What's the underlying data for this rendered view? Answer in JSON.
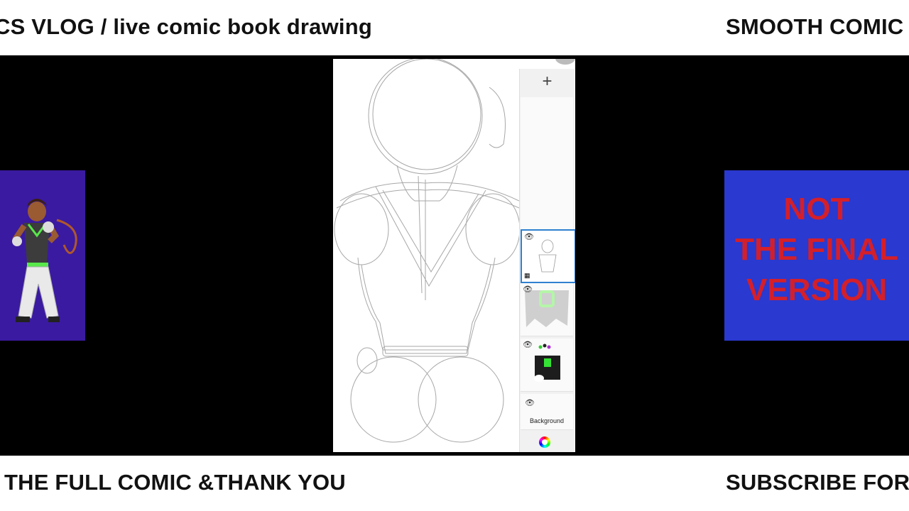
{
  "top_ticker": {
    "left_text": "CS VLOG / live comic book drawing",
    "right_text": "SMOOTH COMIC"
  },
  "bottom_ticker": {
    "left_text": "THE FULL COMIC &THANK YOU",
    "right_text": "SUBSCRIBE FOR"
  },
  "right_card": {
    "lines": [
      "NOT",
      "THE FINAL",
      "VERSION"
    ],
    "background": "#2a39cf",
    "text_color": "#d41f2a"
  },
  "left_card": {
    "background": "#3a1aa0"
  },
  "layer_panel": {
    "add_icon": "plus-icon",
    "background_label": "Background",
    "selected_layer": 1
  }
}
